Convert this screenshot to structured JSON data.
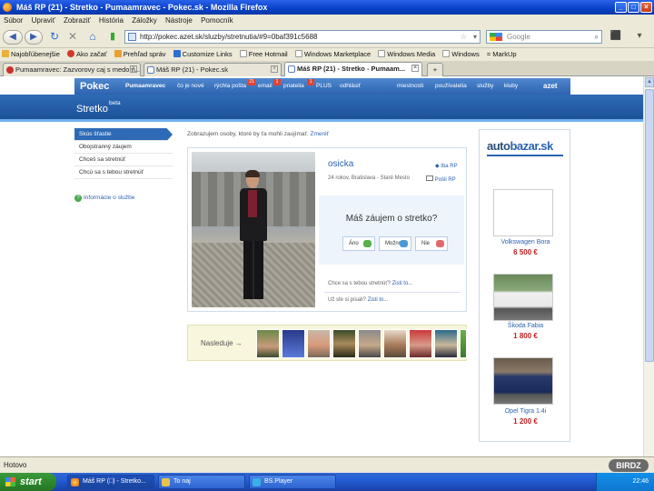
{
  "window": {
    "title": "Máš RP (21) - Stretko - Pumaamravec - Pokec.sk - Mozilla Firefox"
  },
  "menu": [
    "Súbor",
    "Upraviť",
    "Zobraziť",
    "História",
    "Záložky",
    "Nástroje",
    "Pomocník"
  ],
  "address": {
    "url": "http://pokec.azet.sk/sluzby/stretnutia/#9=0baf391c5688"
  },
  "search": {
    "placeholder": "Google"
  },
  "bookmarks": [
    "Najobľúbenejšie",
    "Ako začať",
    "Prehľad správ",
    "Customize Links",
    "Free Hotmail",
    "Windows Marketplace",
    "Windows Media",
    "Windows",
    "= MarkUp"
  ],
  "tabs": [
    "Pumaamravec: Zazvorovy caj s medom...",
    "Máš RP (21) - Pokec.sk",
    "Máš RP (21) - Stretko - Pumaam..."
  ],
  "pokec": {
    "logo": "Pokec",
    "user": "Pumaamravec",
    "nav": {
      "new": "čo je nové",
      "mail": "rýchla pošta",
      "mail_count": "21",
      "email": "email",
      "email_count": "1",
      "friends": "priatelia",
      "friends_count": "1",
      "plus": "PLUS",
      "logout": "odhlásiť",
      "rooms": "miestnosti",
      "users": "používatelia",
      "services": "služby",
      "clubs": "kluby",
      "azet": "azet"
    },
    "section_title": "Stretko",
    "section_sup": "beta"
  },
  "sidebar": {
    "items": [
      "Skús šťastie",
      "Obojstranný záujem",
      "Chceš sa stretnúť",
      "Chcú sa s tebou stretnúť"
    ],
    "info": "Informácie o službe"
  },
  "main": {
    "intro": "Zobrazujem osoby, ktoré by ťa mohli zaujímať.",
    "change": "Zmeniť",
    "profile": {
      "name": "osicka",
      "meta": "24 rokov, Bratislava - Staré Mesto",
      "rp_only": "Iba RP",
      "send_rp": "Pošli RP"
    },
    "question": "Máš záujem o stretko?",
    "answers": {
      "yes": "Áno",
      "maybe": "Možno",
      "no": "Nie"
    },
    "want_q": "Chce sa s tebou stretnúť?",
    "wrote_q": "Už ste si písali?",
    "find_out": "Zisti to...",
    "next": "Nasleduje →"
  },
  "ads": {
    "logo_a": "auto",
    "logo_b": "bazar.sk",
    "cars": [
      {
        "name": "Volkswagen Bora",
        "price": "6 500 €"
      },
      {
        "name": "Škoda Fabia",
        "price": "1 800 €"
      },
      {
        "name": "Opel Tigra 1.4i",
        "price": "1 200 €"
      }
    ]
  },
  "status": {
    "text": "Hotovo",
    "watermark": "BIRDZ"
  },
  "taskbar": {
    "start": "start",
    "tasks": [
      "Máš RP (□) - Stretko...",
      "To naj",
      "BS.Player"
    ],
    "clock": "22:46"
  }
}
